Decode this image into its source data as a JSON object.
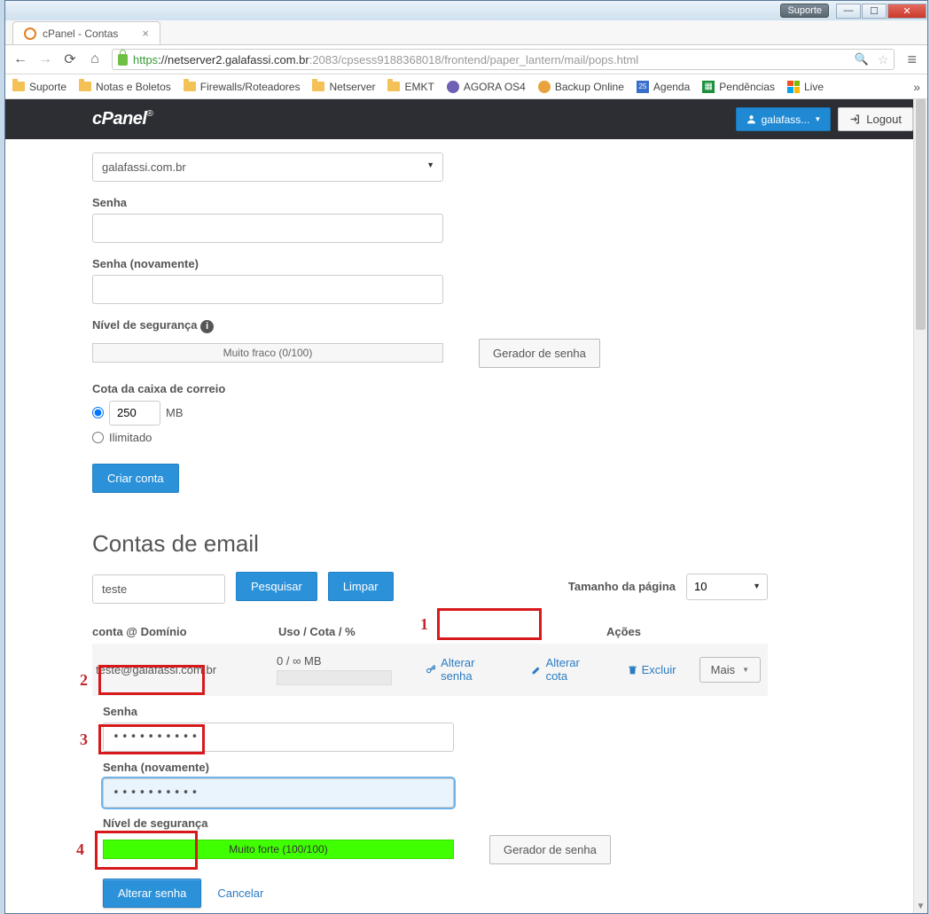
{
  "titlebar": {
    "suporte": "Suporte"
  },
  "tab": {
    "title": "cPanel - Contas"
  },
  "url": {
    "https": "https",
    "domain": "://netserver2.galafassi.com.br",
    "path": ":2083/cpsess9188368018/frontend/paper_lantern/mail/pops.html"
  },
  "bookmarks": {
    "suporte": "Suporte",
    "notas": "Notas e Boletos",
    "firewalls": "Firewalls/Roteadores",
    "netserver": "Netserver",
    "emkt": "EMKT",
    "agora": "AGORA OS4",
    "backup": "Backup Online",
    "agenda": "Agenda",
    "agenda_num": "25",
    "pendencias": "Pendências",
    "live": "Live"
  },
  "header": {
    "logo": "cPanel",
    "reg": "®",
    "user": "galafass...",
    "logout": "Logout"
  },
  "form": {
    "dominio_value": "galafassi.com.br",
    "senha_label": "Senha",
    "senha2_label": "Senha (novamente)",
    "seguranca_label": "Nível de segurança",
    "seguranca_value": "Muito fraco (0/100)",
    "gerador": "Gerador de senha",
    "cota_label": "Cota da caixa de correio",
    "cota_value": "250",
    "cota_mb": "MB",
    "ilimitado": "Ilimitado",
    "criar": "Criar conta"
  },
  "section_title": "Contas de email",
  "search": {
    "value": "teste",
    "pesquisar": "Pesquisar",
    "limpar": "Limpar",
    "page_label": "Tamanho da página",
    "page_value": "10"
  },
  "table": {
    "h_conta": "conta @ Domínio",
    "h_uso": "Uso / Cota / %",
    "h_acoes": "Ações",
    "row_account": "teste@galafassi.com.br",
    "row_uso": "0 / ∞ MB",
    "alterar_senha": "Alterar senha",
    "alterar_cota": "Alterar cota",
    "excluir": "Excluir",
    "mais": "Mais"
  },
  "pwpanel": {
    "senha_label": "Senha",
    "senha_value": "••••••••••",
    "senha2_label": "Senha (novamente)",
    "senha2_value": "••••••••••",
    "nivel_label": "Nível de segurança",
    "nivel_value": "Muito forte (100/100)",
    "gerador": "Gerador de senha",
    "alterar": "Alterar senha",
    "cancelar": "Cancelar"
  },
  "annot": {
    "n1": "1",
    "n2": "2",
    "n3": "3",
    "n4": "4"
  }
}
